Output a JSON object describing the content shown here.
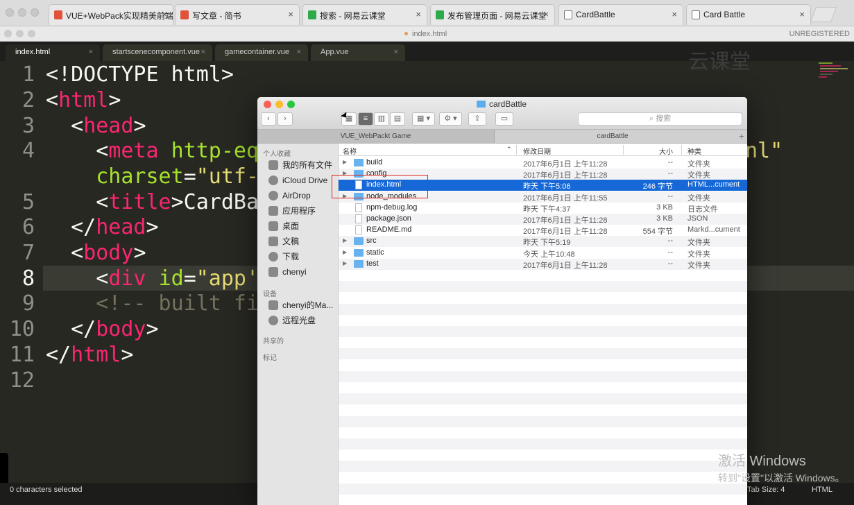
{
  "browser": {
    "tabs": [
      {
        "label": "VUE+WebPack实现精美前端",
        "favicon_color": "#e0523a"
      },
      {
        "label": "写文章 - 简书",
        "favicon_color": "#e0523a"
      },
      {
        "label": "搜索 - 网易云课堂",
        "favicon_color": "#2eaa4a"
      },
      {
        "label": "发布管理页面 - 网易云课堂",
        "favicon_color": "#2eaa4a"
      },
      {
        "label": "CardBattle",
        "favicon_color": "#ffffff"
      },
      {
        "label": "Card Battle",
        "favicon_color": "#ffffff"
      }
    ]
  },
  "sublime": {
    "window_title": "index.html",
    "registration": "UNREGISTERED",
    "tabs": [
      "index.html",
      "startscenecomponent.vue",
      "gamecontainer.vue",
      "App.vue"
    ],
    "line_numbers": [
      "1",
      "2",
      "3",
      "4",
      "",
      "5",
      "6",
      "7",
      "8",
      "9",
      "10",
      "11",
      "12"
    ],
    "code_line_4_tail": "nl\"",
    "status_left": "0 characters selected",
    "status_tab": "Tab Size: 4",
    "status_syntax": "HTML"
  },
  "watermark_logo": "云课堂",
  "finder": {
    "title": "cardBattle",
    "search_placeholder": "搜索",
    "tabs": [
      "VUE_WebPackt Game",
      "cardBattle"
    ],
    "sidebar": {
      "favorites_header": "个人收藏",
      "favorites": [
        {
          "label": "我的所有文件",
          "icon": "all-files-icon"
        },
        {
          "label": "iCloud Drive",
          "icon": "cloud-icon"
        },
        {
          "label": "AirDrop",
          "icon": "airdrop-icon"
        },
        {
          "label": "应用程序",
          "icon": "applications-icon"
        },
        {
          "label": "桌面",
          "icon": "desktop-icon"
        },
        {
          "label": "文稿",
          "icon": "documents-icon"
        },
        {
          "label": "下载",
          "icon": "downloads-icon"
        },
        {
          "label": "chenyi",
          "icon": "home-icon"
        }
      ],
      "devices_header": "设备",
      "devices": [
        {
          "label": "chenyi的Ma...",
          "icon": "laptop-icon"
        },
        {
          "label": "远程光盘",
          "icon": "disc-icon"
        }
      ],
      "shared_header": "共享的",
      "tags_header": "标记"
    },
    "columns": {
      "name": "名称",
      "date": "修改日期",
      "size": "大小",
      "kind": "种类"
    },
    "files": [
      {
        "name": "build",
        "date": "2017年6月1日 上午11:28",
        "size": "--",
        "kind": "文件夹",
        "type": "folder",
        "expandable": true
      },
      {
        "name": "config",
        "date": "2017年6月1日 上午11:28",
        "size": "--",
        "kind": "文件夹",
        "type": "folder",
        "expandable": true
      },
      {
        "name": "index.html",
        "date": "昨天 下午5:06",
        "size": "246 字节",
        "kind": "HTML...cument",
        "type": "file",
        "expandable": false,
        "selected": true
      },
      {
        "name": "node_modules",
        "date": "2017年6月1日 上午11:55",
        "size": "--",
        "kind": "文件夹",
        "type": "folder",
        "expandable": true
      },
      {
        "name": "npm-debug.log",
        "date": "昨天 下午4:37",
        "size": "3 KB",
        "kind": "日志文件",
        "type": "file",
        "expandable": false
      },
      {
        "name": "package.json",
        "date": "2017年6月1日 上午11:28",
        "size": "3 KB",
        "kind": "JSON",
        "type": "file",
        "expandable": false
      },
      {
        "name": "README.md",
        "date": "2017年6月1日 上午11:28",
        "size": "554 字节",
        "kind": "Markd...cument",
        "type": "file",
        "expandable": false
      },
      {
        "name": "src",
        "date": "昨天 下午5:19",
        "size": "--",
        "kind": "文件夹",
        "type": "folder",
        "expandable": true
      },
      {
        "name": "static",
        "date": "今天 上午10:48",
        "size": "--",
        "kind": "文件夹",
        "type": "folder",
        "expandable": true
      },
      {
        "name": "test",
        "date": "2017年6月1日 上午11:28",
        "size": "--",
        "kind": "文件夹",
        "type": "folder",
        "expandable": true
      }
    ]
  },
  "activation": {
    "line1": "激活 Windows",
    "line2": "转到\"设置\"以激活 Windows。"
  }
}
